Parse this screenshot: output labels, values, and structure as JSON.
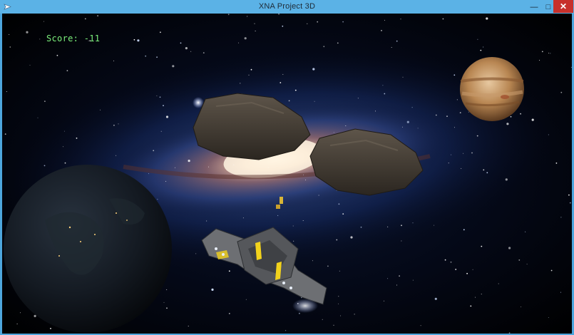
{
  "window": {
    "title": "XNA Project 3D",
    "controls": {
      "minimize_icon": "minimize-icon",
      "maximize_icon": "maximize-icon",
      "close_icon": "close-icon"
    }
  },
  "hud": {
    "score_label": "Score:",
    "score_value": "-11",
    "score_color": "#7cf07c"
  },
  "scene": {
    "background": "spiral galaxy starfield",
    "objects": [
      "earth-planet",
      "jupiter-planet",
      "asteroid",
      "asteroid",
      "spaceship",
      "projectile"
    ]
  },
  "colors": {
    "titlebar": "#5bb2e6",
    "close_button": "#c7302b",
    "space": "#000000"
  }
}
